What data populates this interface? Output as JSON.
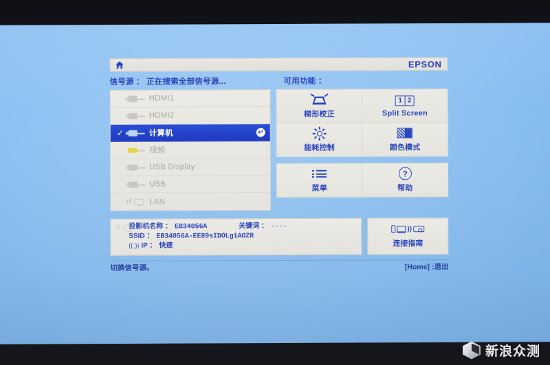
{
  "header": {
    "home_icon": "home-icon",
    "brand": "EPSON"
  },
  "sections": {
    "source_label": "信号源 ： 正在搜索全部信号源...",
    "functions_label": "可用功能 ："
  },
  "sources": [
    {
      "name": "HDMI1",
      "icon": "hdmi-plug-icon",
      "selected": false
    },
    {
      "name": "HDMI2",
      "icon": "hdmi-plug-icon",
      "selected": false
    },
    {
      "name": "计算机",
      "icon": "vga-plug-icon",
      "selected": true,
      "check": "✓",
      "enter": "↵"
    },
    {
      "name": "视频",
      "icon": "rca-plug-icon",
      "selected": false
    },
    {
      "name": "USB Display",
      "icon": "usb-plug-icon",
      "selected": false
    },
    {
      "name": "USB",
      "icon": "usb-plug-icon",
      "selected": false
    },
    {
      "name": "LAN",
      "icon": "lan-monitor-icon",
      "selected": false
    }
  ],
  "functions_primary": [
    {
      "label": "梯形校正",
      "icon": "keystone-icon"
    },
    {
      "label": "Split Screen",
      "icon": "split-screen-icon",
      "icon_left": "1",
      "icon_right": "2"
    },
    {
      "label": "能耗控制",
      "icon": "power-consumption-icon"
    },
    {
      "label": "颜色模式",
      "icon": "color-mode-icon"
    }
  ],
  "functions_secondary": [
    {
      "label": "菜单",
      "icon": "menu-list-icon"
    },
    {
      "label": "帮助",
      "icon": "help-circle-icon",
      "glyph": "?"
    }
  ],
  "info": {
    "projector_name_key": "投影机名称 ：",
    "projector_name_value": "EB34056A",
    "keyword_key": "关键词 ：",
    "keyword_value": "----",
    "ssid_key": "SSID ：",
    "ssid_value": "EB34056A-EE89sIDOLg1AOZR",
    "ip_key": "IP ：",
    "ip_value": "快速"
  },
  "connection_guide": {
    "label": "连接指南"
  },
  "status": {
    "left": "切换信号源。",
    "right": "[Home] :退出"
  },
  "watermark": {
    "text": "新浪众测"
  },
  "colors": {
    "accent_blue": "#2a46c4",
    "selected_row": "#2442c9",
    "panel_bg": "#eceae5",
    "screen_blue": "#8cc0f2"
  }
}
